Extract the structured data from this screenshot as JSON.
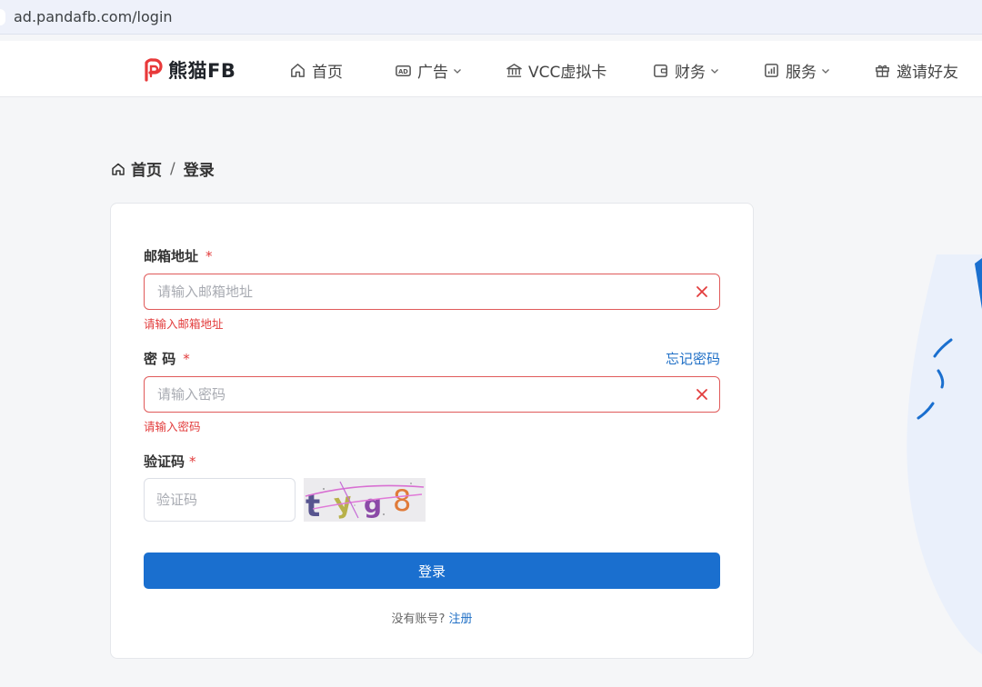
{
  "browser": {
    "url": "ad.pandafb.com/login"
  },
  "nav": {
    "logo_text": "熊猫FB",
    "items": [
      {
        "label": "首页",
        "icon": "home-icon",
        "dropdown": false
      },
      {
        "label": "广告",
        "icon": "ad-icon",
        "dropdown": true
      },
      {
        "label": "VCC虚拟卡",
        "icon": "bank-icon",
        "dropdown": false
      },
      {
        "label": "财务",
        "icon": "wallet-icon",
        "dropdown": true
      },
      {
        "label": "服务",
        "icon": "chart-icon",
        "dropdown": true
      },
      {
        "label": "邀请好友",
        "icon": "gift-icon",
        "dropdown": false
      }
    ]
  },
  "breadcrumb": {
    "home": "首页",
    "separator": "/",
    "current": "登录"
  },
  "form": {
    "email": {
      "label": "邮箱地址",
      "required": "*",
      "value": "",
      "placeholder": "请输入邮箱地址",
      "error": "请输入邮箱地址"
    },
    "password": {
      "label": "密 码",
      "required": "*",
      "value": "",
      "placeholder": "请输入密码",
      "error": "请输入密码",
      "forgot": "忘记密码"
    },
    "captcha": {
      "label": "验证码",
      "required": "*",
      "value": "",
      "placeholder": "验证码",
      "image_text": "tyg8"
    },
    "submit_label": "登录",
    "register_prompt": "没有账号?",
    "register_link": "注册"
  },
  "colors": {
    "primary": "#1a6fcf",
    "error": "#e23c3c",
    "link": "#1f6fc6"
  }
}
